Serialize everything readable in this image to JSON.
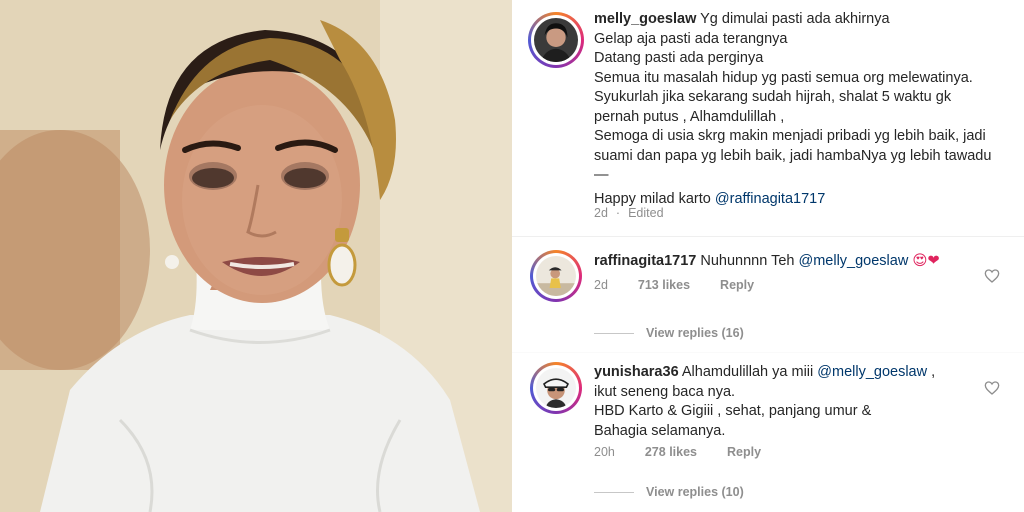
{
  "post": {
    "username": "melly_goeslaw",
    "lines": [
      "Yg dimulai pasti ada akhirnya",
      "Gelap aja pasti ada terangnya",
      "Datang pasti ada perginya",
      "Semua itu masalah hidup yg pasti semua org melewatinya.",
      "Syukurlah jika sekarang sudah hijrah, shalat 5 waktu gk",
      "pernah putus , Alhamdulillah ,",
      "Semoga di usia skrg makin menjadi pribadi yg lebih baik, jadi",
      "suami dan papa yg lebih baik, jadi hambaNya yg lebih tawadu",
      "—"
    ],
    "closing_text": "Happy milad karto ",
    "closing_mention": "@raffinagita1717",
    "time": "2d",
    "edited": "Edited"
  },
  "comments": [
    {
      "username": "raffinagita1717",
      "text": "Nuhunnnn Teh ",
      "mention": "@melly_goeslaw",
      "emoji": "😍❤",
      "time": "2d",
      "likes": "713 likes",
      "reply": "Reply",
      "view_replies": "View replies (16)"
    },
    {
      "username": "yunishara36",
      "first_line": "Alhamdulillah ya miii ",
      "mention": "@melly_goeslaw",
      "first_line_end": " ,",
      "lines": [
        "ikut seneng baca nya.",
        "HBD Karto & Gigiii , sehat, panjang umur &",
        "Bahagia selamanya."
      ],
      "time": "20h",
      "likes": "278 likes",
      "reply": "Reply",
      "view_replies": "View replies (10)"
    }
  ],
  "colors": {
    "text": "#262626",
    "mention": "#00376b",
    "muted": "#8e8e8e",
    "heart_emoji": "#e0245e"
  },
  "icons": {
    "like": "heart-outline-icon"
  }
}
